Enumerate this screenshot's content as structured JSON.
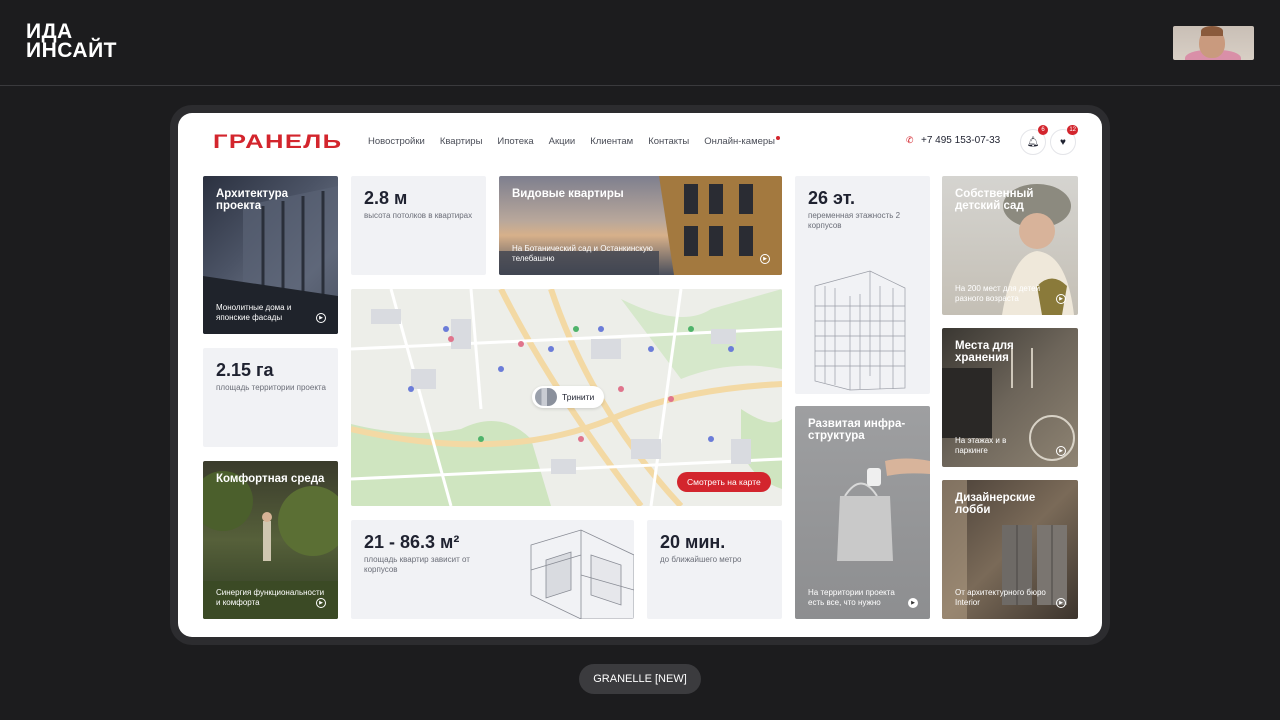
{
  "brand": {
    "line1": "ИДА",
    "line2": "ИНСАЙТ"
  },
  "caption": "GRANELLE [NEW]",
  "site": {
    "logo": "ГРАНЕЛЬ",
    "nav": [
      "Новостройки",
      "Квартиры",
      "Ипотека",
      "Акции",
      "Клиентам",
      "Контакты",
      "Онлайн-камеры"
    ],
    "phone": "+7 495 153-07-33",
    "notifications_count": "6",
    "favorites_count": "12"
  },
  "cards": {
    "architecture": {
      "title": "Архитектура проекта",
      "subtitle": "Монолитные дома и японские фасады"
    },
    "ceiling": {
      "value": "2.8 м",
      "label": "высота потолков в квартирах"
    },
    "views": {
      "title": "Видовые квартиры",
      "subtitle": "На Ботанический сад и Останкинскую телебашню"
    },
    "floors": {
      "value": "26 эт.",
      "label": "переменная этажность 2 корпусов"
    },
    "kindergarten": {
      "title": "Собственный детский сад",
      "subtitle": "На 200 мест для детей разного возраста"
    },
    "area": {
      "value": "2.15 га",
      "label": "площадь территории проекта"
    },
    "storage": {
      "title": "Места для хранения",
      "subtitle": "На этажах и в паркинге"
    },
    "comfort": {
      "title": "Комфортная среда",
      "subtitle": "Синергия функциональности и комфорта"
    },
    "infrastructure": {
      "title": "Развитая инфра-структура",
      "subtitle": "На территории проекта есть все, что нужно"
    },
    "lobby": {
      "title": "Дизайнерские лобби",
      "subtitle": "От архитектурного бюро Interior"
    },
    "apartments": {
      "value": "21 - 86.3 м²",
      "label": "площадь квартир зависит от корпусов"
    },
    "metro": {
      "value": "20 мин.",
      "label": "до ближайшего метро"
    }
  },
  "map": {
    "pin_label": "Тринити",
    "button": "Смотреть на карте"
  },
  "colors": {
    "accent": "#d3252d",
    "stat_bg": "#f1f2f5",
    "outer_bg": "#1c1c1e"
  }
}
